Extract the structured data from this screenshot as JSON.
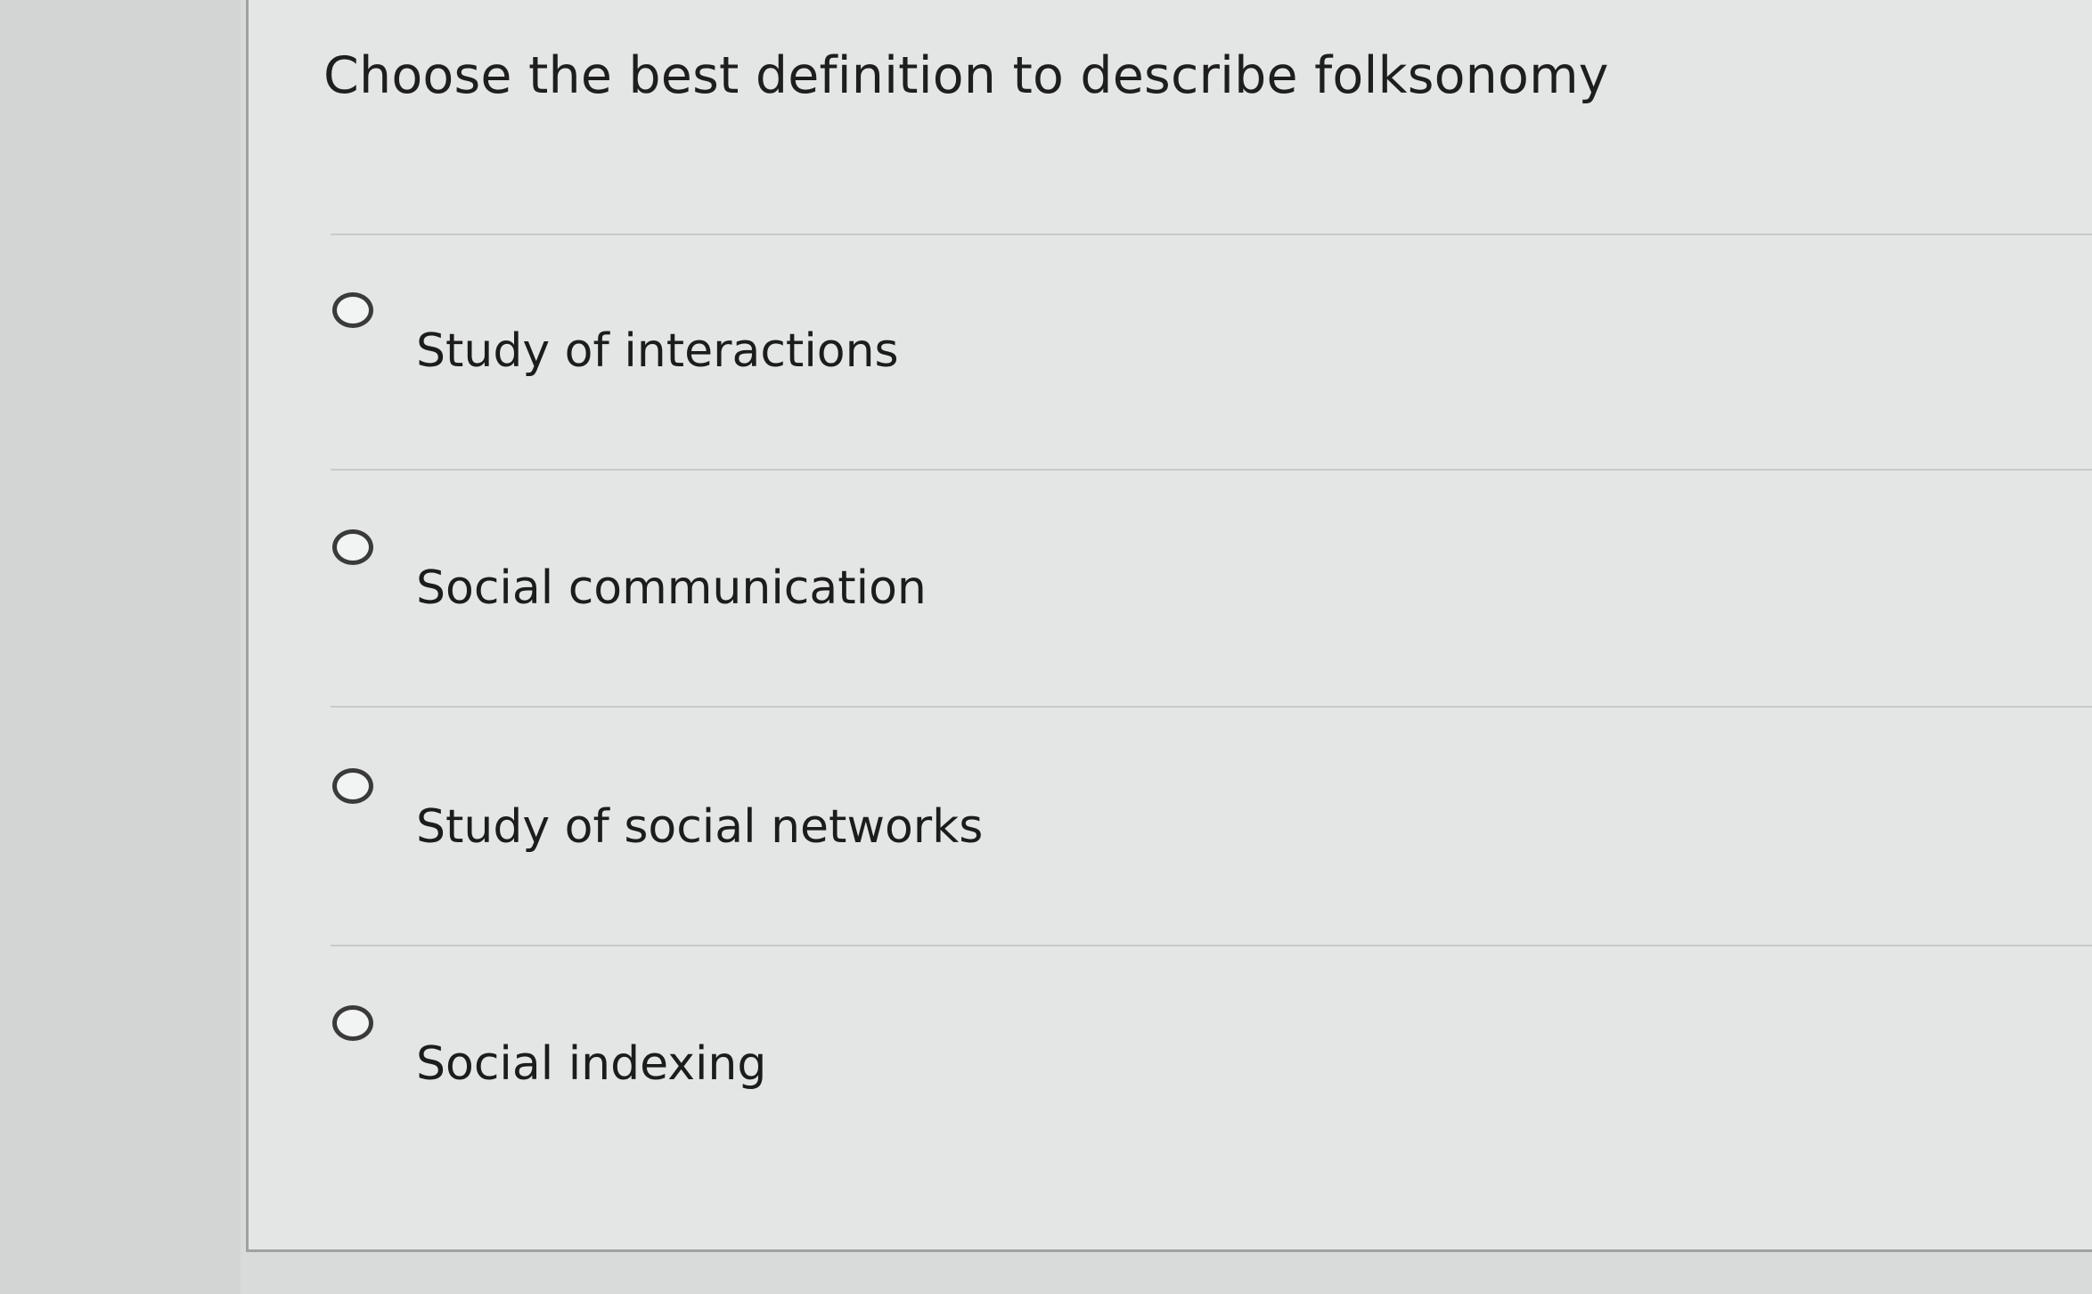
{
  "question": {
    "text": "Choose the best definition to describe folksonomy"
  },
  "options": [
    {
      "label": "Study of interactions",
      "selected": false
    },
    {
      "label": "Social communication",
      "selected": false
    },
    {
      "label": "Study of social networks",
      "selected": false
    },
    {
      "label": "Social indexing",
      "selected": false
    }
  ],
  "colors": {
    "background": "#d9dbdb",
    "panel": "#e4e6e6",
    "text": "#1c1c1c",
    "radio_border": "#3a3a3a"
  }
}
